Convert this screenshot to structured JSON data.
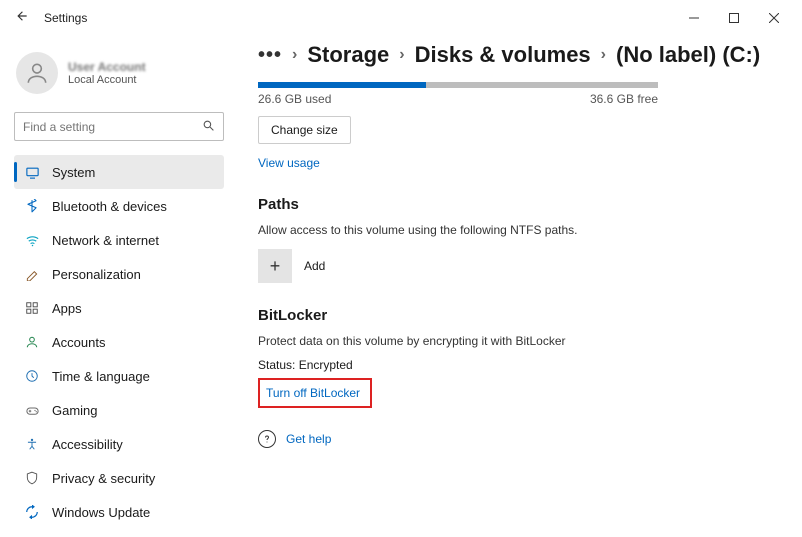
{
  "window": {
    "title": "Settings"
  },
  "user": {
    "name": "User Account",
    "subtitle": "Local Account"
  },
  "search": {
    "placeholder": "Find a setting"
  },
  "nav": [
    {
      "label": "System",
      "icon_color": "#0067c0",
      "active": true
    },
    {
      "label": "Bluetooth & devices",
      "icon_color": "#0067c0"
    },
    {
      "label": "Network & internet",
      "icon_color": "#0aa3c2"
    },
    {
      "label": "Personalization",
      "icon_color": "#8a5a2b"
    },
    {
      "label": "Apps",
      "icon_color": "#4a4a4a"
    },
    {
      "label": "Accounts",
      "icon_color": "#2e8b57"
    },
    {
      "label": "Time & language",
      "icon_color": "#1f6fb2"
    },
    {
      "label": "Gaming",
      "icon_color": "#6b6b6b"
    },
    {
      "label": "Accessibility",
      "icon_color": "#1f6fb2"
    },
    {
      "label": "Privacy & security",
      "icon_color": "#555"
    },
    {
      "label": "Windows Update",
      "icon_color": "#0067c0"
    }
  ],
  "breadcrumb": {
    "items": [
      "Storage",
      "Disks & volumes",
      "(No label) (C:)"
    ]
  },
  "storage": {
    "used_label": "26.6 GB used",
    "free_label": "36.6 GB free",
    "used_gb": 26.6,
    "total_gb": 63.2,
    "change_size_label": "Change size",
    "view_usage_label": "View usage"
  },
  "paths": {
    "heading": "Paths",
    "description": "Allow access to this volume using the following NTFS paths.",
    "add_label": "Add"
  },
  "bitlocker": {
    "heading": "BitLocker",
    "description": "Protect data on this volume by encrypting it with BitLocker",
    "status_label": "Status: Encrypted",
    "turn_off_label": "Turn off BitLocker"
  },
  "help": {
    "label": "Get help"
  }
}
